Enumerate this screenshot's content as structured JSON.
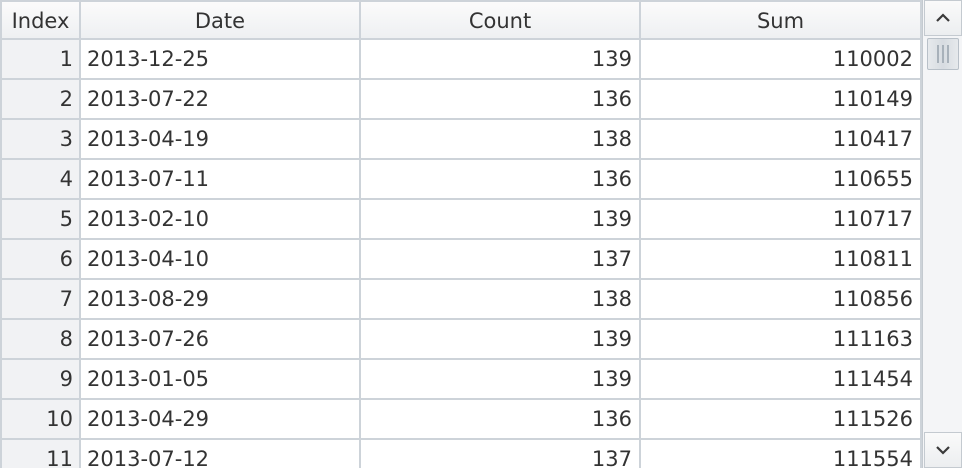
{
  "table": {
    "columns": [
      "Index",
      "Date",
      "Count",
      "Sum"
    ],
    "rows": [
      {
        "index": "1",
        "date": "2013-12-25",
        "count": "139",
        "sum": "110002"
      },
      {
        "index": "2",
        "date": "2013-07-22",
        "count": "136",
        "sum": "110149"
      },
      {
        "index": "3",
        "date": "2013-04-19",
        "count": "138",
        "sum": "110417"
      },
      {
        "index": "4",
        "date": "2013-07-11",
        "count": "136",
        "sum": "110655"
      },
      {
        "index": "5",
        "date": "2013-02-10",
        "count": "139",
        "sum": "110717"
      },
      {
        "index": "6",
        "date": "2013-04-10",
        "count": "137",
        "sum": "110811"
      },
      {
        "index": "7",
        "date": "2013-08-29",
        "count": "138",
        "sum": "110856"
      },
      {
        "index": "8",
        "date": "2013-07-26",
        "count": "139",
        "sum": "111163"
      },
      {
        "index": "9",
        "date": "2013-01-05",
        "count": "139",
        "sum": "111454"
      },
      {
        "index": "10",
        "date": "2013-04-29",
        "count": "136",
        "sum": "111526"
      },
      {
        "index": "11",
        "date": "2013-07-12",
        "count": "137",
        "sum": "111554"
      }
    ]
  },
  "scrollbar": {
    "up_icon": "chevron-up-icon",
    "down_icon": "chevron-down-icon",
    "position_fraction": 0.0
  },
  "colors": {
    "grid_line": "#cdd3d9",
    "index_bg": "#f1f2f4",
    "text": "#333333"
  }
}
